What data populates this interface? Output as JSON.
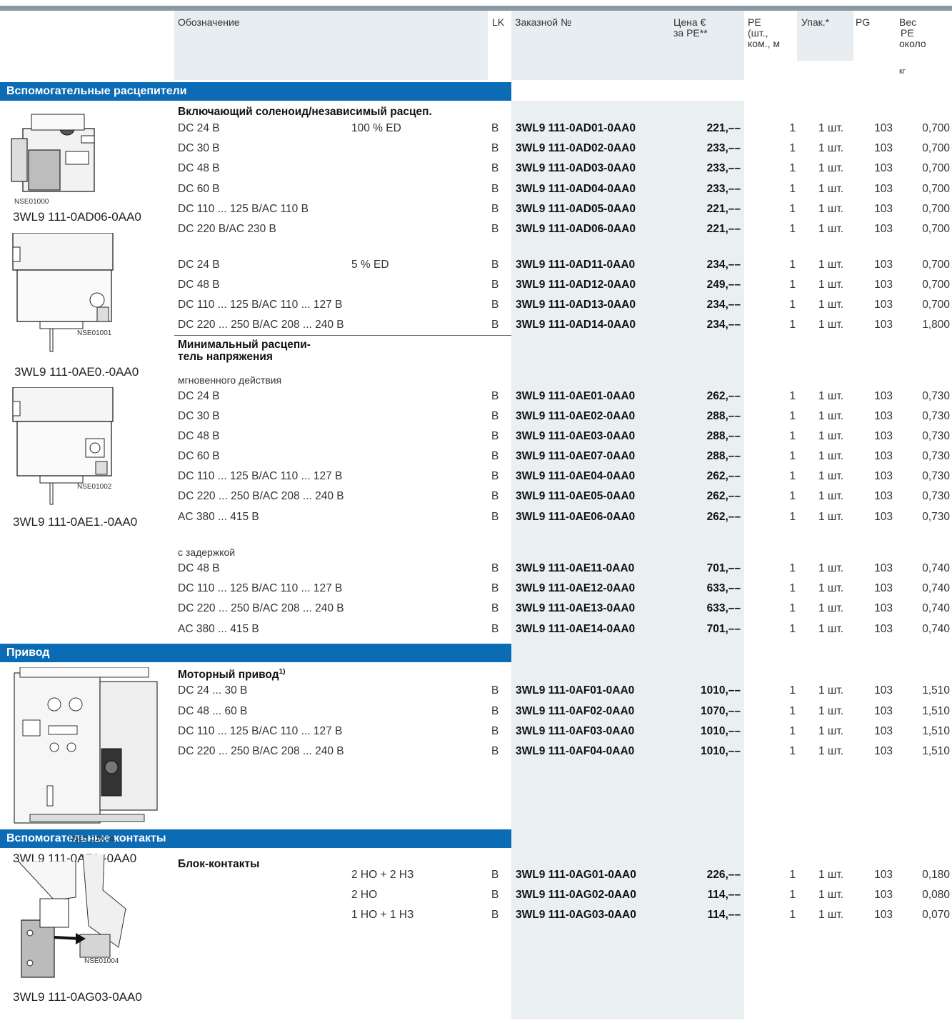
{
  "header": {
    "designation": "Обозначение",
    "lk": "LK",
    "order_no": "Заказной №",
    "price": [
      "Цена €",
      "за PE**"
    ],
    "pe": [
      "PE",
      "(шт.,",
      "ком., м"
    ],
    "pack": "Упак.*",
    "pg": "PG",
    "weight": [
      "Вес",
      "PE",
      "около"
    ],
    "weight_unit": "кг"
  },
  "sections": {
    "aux_trip": "Вспомогательные расцепители",
    "drive": "Привод",
    "aux_contacts": "Вспомогательные контакты"
  },
  "groups": {
    "solenoid": "Включающий соленоид/независимый расцеп.",
    "undervoltage": [
      "Минимальный расцепи-",
      "тель напряжения"
    ],
    "instant": "мгновенного действия",
    "delayed": "с задержкой",
    "motor": "Моторный привод",
    "motor_sup": "1)",
    "block": "Блок-контакты"
  },
  "image_labels": {
    "img1_code": "NSE01000",
    "img1_caption": "3WL9 111-0AD06-0AA0",
    "img2_code": "NSE01001",
    "img2_caption": "3WL9 111-0AE0.-0AA0",
    "img3_code": "NSE01002",
    "img3_caption": "3WL9 111-0AE1.-0AA0",
    "img4_code": "NSE0_01003a",
    "img4_caption": "3WL9 111-0AF0.-0AA0",
    "img5_code": "NSE01004",
    "img5_caption": "3WL9 111-0AG03-0AA0"
  },
  "rows": [
    {
      "desc": "DC   24 В",
      "extra": "100 % ED",
      "lk": "B",
      "order": "3WL9 111-0AD01-0AA0",
      "price": "221,––",
      "pe": "1",
      "pack": "1 шт.",
      "pg": "103",
      "weight": "0,700"
    },
    {
      "desc": "DC   30 В",
      "extra": "",
      "lk": "B",
      "order": "3WL9 111-0AD02-0AA0",
      "price": "233,––",
      "pe": "1",
      "pack": "1 шт.",
      "pg": "103",
      "weight": "0,700"
    },
    {
      "desc": "DC   48 В",
      "extra": "",
      "lk": "B",
      "order": "3WL9 111-0AD03-0AA0",
      "price": "233,––",
      "pe": "1",
      "pack": "1 шт.",
      "pg": "103",
      "weight": "0,700"
    },
    {
      "desc": "DC   60 В",
      "extra": "",
      "lk": "B",
      "order": "3WL9 111-0AD04-0AA0",
      "price": "233,––",
      "pe": "1",
      "pack": "1 шт.",
      "pg": "103",
      "weight": "0,700"
    },
    {
      "desc": "DC 110 ... 125 В/AC 110 В",
      "extra": "",
      "lk": "B",
      "order": "3WL9 111-0AD05-0AA0",
      "price": "221,––",
      "pe": "1",
      "pack": "1 шт.",
      "pg": "103",
      "weight": "0,700"
    },
    {
      "desc": "DC 220 В/AC 230 В",
      "extra": "",
      "lk": "B",
      "order": "3WL9 111-0AD06-0AA0",
      "price": "221,––",
      "pe": "1",
      "pack": "1 шт.",
      "pg": "103",
      "weight": "0,700"
    },
    {
      "desc": "DC   24 В",
      "extra": "5 % ED",
      "lk": "B",
      "order": "3WL9 111-0AD11-0AA0",
      "price": "234,––",
      "pe": "1",
      "pack": "1 шт.",
      "pg": "103",
      "weight": "0,700"
    },
    {
      "desc": "DC   48 В",
      "extra": "",
      "lk": "B",
      "order": "3WL9 111-0AD12-0AA0",
      "price": "249,––",
      "pe": "1",
      "pack": "1 шт.",
      "pg": "103",
      "weight": "0,700"
    },
    {
      "desc": "DC 110 ... 125 В/AC 110 ... 127 В",
      "extra": "",
      "lk": "B",
      "order": "3WL9 111-0AD13-0AA0",
      "price": "234,––",
      "pe": "1",
      "pack": "1 шт.",
      "pg": "103",
      "weight": "0,700"
    },
    {
      "desc": "DC 220 ... 250 В/AC 208 ... 240 В",
      "extra": "",
      "lk": "B",
      "order": "3WL9 111-0AD14-0AA0",
      "price": "234,––",
      "pe": "1",
      "pack": "1 шт.",
      "pg": "103",
      "weight": "1,800"
    },
    {
      "desc": "DC   24 В",
      "extra": "",
      "lk": "B",
      "order": "3WL9 111-0AE01-0AA0",
      "price": "262,––",
      "pe": "1",
      "pack": "1 шт.",
      "pg": "103",
      "weight": "0,730"
    },
    {
      "desc": "DC   30 В",
      "extra": "",
      "lk": "B",
      "order": "3WL9 111-0AE02-0AA0",
      "price": "288,––",
      "pe": "1",
      "pack": "1 шт.",
      "pg": "103",
      "weight": "0,730"
    },
    {
      "desc": "DC   48 В",
      "extra": "",
      "lk": "B",
      "order": "3WL9 111-0AE03-0AA0",
      "price": "288,––",
      "pe": "1",
      "pack": "1 шт.",
      "pg": "103",
      "weight": "0,730"
    },
    {
      "desc": "DC   60 В",
      "extra": "",
      "lk": "B",
      "order": "3WL9 111-0AE07-0AA0",
      "price": "288,––",
      "pe": "1",
      "pack": "1 шт.",
      "pg": "103",
      "weight": "0,730"
    },
    {
      "desc": "DC 110 ... 125 В/AC 110 ... 127 В",
      "extra": "",
      "lk": "B",
      "order": "3WL9 111-0AE04-0AA0",
      "price": "262,––",
      "pe": "1",
      "pack": "1 шт.",
      "pg": "103",
      "weight": "0,730"
    },
    {
      "desc": "DC 220 ... 250 В/AC 208 ... 240 В",
      "extra": "",
      "lk": "B",
      "order": "3WL9 111-0AE05-0AA0",
      "price": "262,––",
      "pe": "1",
      "pack": "1 шт.",
      "pg": "103",
      "weight": "0,730"
    },
    {
      "desc": "AC 380 ... 415 В",
      "extra": "",
      "lk": "B",
      "order": "3WL9 111-0AE06-0AA0",
      "price": "262,––",
      "pe": "1",
      "pack": "1 шт.",
      "pg": "103",
      "weight": "0,730"
    },
    {
      "desc": "DC   48 В",
      "extra": "",
      "lk": "B",
      "order": "3WL9 111-0AE11-0AA0",
      "price": "701,––",
      "pe": "1",
      "pack": "1 шт.",
      "pg": "103",
      "weight": "0,740"
    },
    {
      "desc": "DC 110 ... 125 В/AC 110 ... 127 В",
      "extra": "",
      "lk": "B",
      "order": "3WL9 111-0AE12-0AA0",
      "price": "633,––",
      "pe": "1",
      "pack": "1 шт.",
      "pg": "103",
      "weight": "0,740"
    },
    {
      "desc": "DC 220 ... 250 В/AC 208 ... 240 В",
      "extra": "",
      "lk": "B",
      "order": "3WL9 111-0AE13-0AA0",
      "price": "633,––",
      "pe": "1",
      "pack": "1 шт.",
      "pg": "103",
      "weight": "0,740"
    },
    {
      "desc": "AC 380 ... 415 В",
      "extra": "",
      "lk": "B",
      "order": "3WL9 111-0AE14-0AA0",
      "price": "701,––",
      "pe": "1",
      "pack": "1 шт.",
      "pg": "103",
      "weight": "0,740"
    },
    {
      "desc": "DC   24 ... 30 В",
      "extra": "",
      "lk": "B",
      "order": "3WL9 111-0AF01-0AA0",
      "price": "1010,––",
      "pe": "1",
      "pack": "1 шт.",
      "pg": "103",
      "weight": "1,510"
    },
    {
      "desc": "DC   48 ... 60 В",
      "extra": "",
      "lk": "B",
      "order": "3WL9 111-0AF02-0AA0",
      "price": "1070,––",
      "pe": "1",
      "pack": "1 шт.",
      "pg": "103",
      "weight": "1,510"
    },
    {
      "desc": "DC 110 ... 125 В/AC 110 ... 127 В",
      "extra": "",
      "lk": "B",
      "order": "3WL9 111-0AF03-0AA0",
      "price": "1010,––",
      "pe": "1",
      "pack": "1 шт.",
      "pg": "103",
      "weight": "1,510"
    },
    {
      "desc": "DC 220 ... 250 В/AC 208 ... 240 В",
      "extra": "",
      "lk": "B",
      "order": "3WL9 111-0AF04-0AA0",
      "price": "1010,––",
      "pe": "1",
      "pack": "1 шт.",
      "pg": "103",
      "weight": "1,510"
    },
    {
      "desc": "",
      "extra": "2 НО + 2 НЗ",
      "lk": "B",
      "order": "3WL9 111-0AG01-0AA0",
      "price": "226,––",
      "pe": "1",
      "pack": "1 шт.",
      "pg": "103",
      "weight": "0,180"
    },
    {
      "desc": "",
      "extra": "2 НО",
      "lk": "B",
      "order": "3WL9 111-0AG02-0AA0",
      "price": "114,––",
      "pe": "1",
      "pack": "1 шт.",
      "pg": "103",
      "weight": "0,080"
    },
    {
      "desc": "",
      "extra": "1 НО + 1 НЗ",
      "lk": "B",
      "order": "3WL9 111-0AG03-0AA0",
      "price": "114,––",
      "pe": "1",
      "pack": "1 шт.",
      "pg": "103",
      "weight": "0,070"
    }
  ]
}
